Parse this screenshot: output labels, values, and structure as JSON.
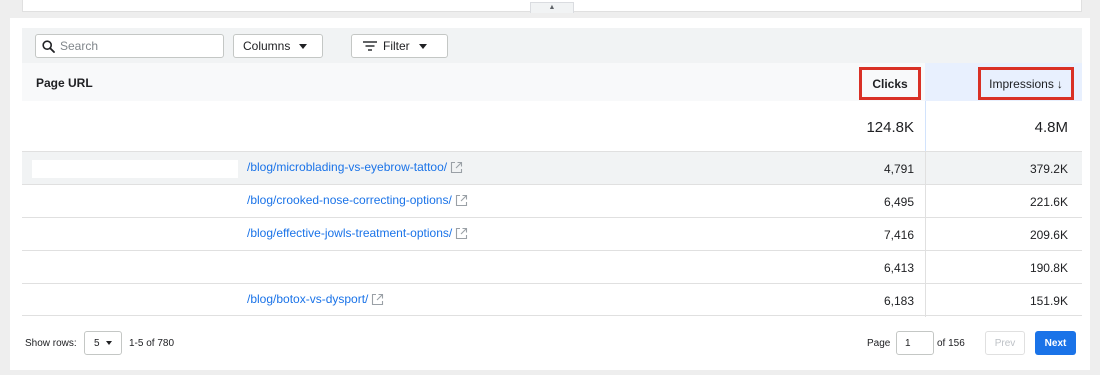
{
  "top_panel": {
    "expand_glyph": "▲"
  },
  "toolbar": {
    "search_placeholder": "Search",
    "columns_label": "Columns",
    "filter_label": "Filter"
  },
  "table": {
    "headers": {
      "url": "Page URL",
      "clicks": "Clicks",
      "impressions": "Impressions"
    },
    "sort_indicator": "↓",
    "totals": {
      "clicks": "124.8K",
      "impressions": "4.8M"
    },
    "rows": [
      {
        "url": "/blog/microblading-vs-eyebrow-tattoo/",
        "clicks": "4,791",
        "impressions": "379.2K"
      },
      {
        "url": "/blog/crooked-nose-correcting-options/",
        "clicks": "6,495",
        "impressions": "221.6K"
      },
      {
        "url": "/blog/effective-jowls-treatment-options/",
        "clicks": "7,416",
        "impressions": "209.6K"
      },
      {
        "url": "",
        "clicks": "6,413",
        "impressions": "190.8K"
      },
      {
        "url": "/blog/botox-vs-dysport/",
        "clicks": "6,183",
        "impressions": "151.9K"
      }
    ]
  },
  "pagination": {
    "show_rows_label": "Show rows:",
    "rows_per_page": "5",
    "range_text": "1-5 of 780",
    "page_label": "Page",
    "current_page": "1",
    "of_pages": "of 156",
    "prev_label": "Prev",
    "next_label": "Next"
  },
  "colors": {
    "link": "#1a73e8",
    "highlight_border": "#d93025",
    "sorted_column_bg": "#e8f0fe",
    "next_button": "#1a73e8"
  }
}
